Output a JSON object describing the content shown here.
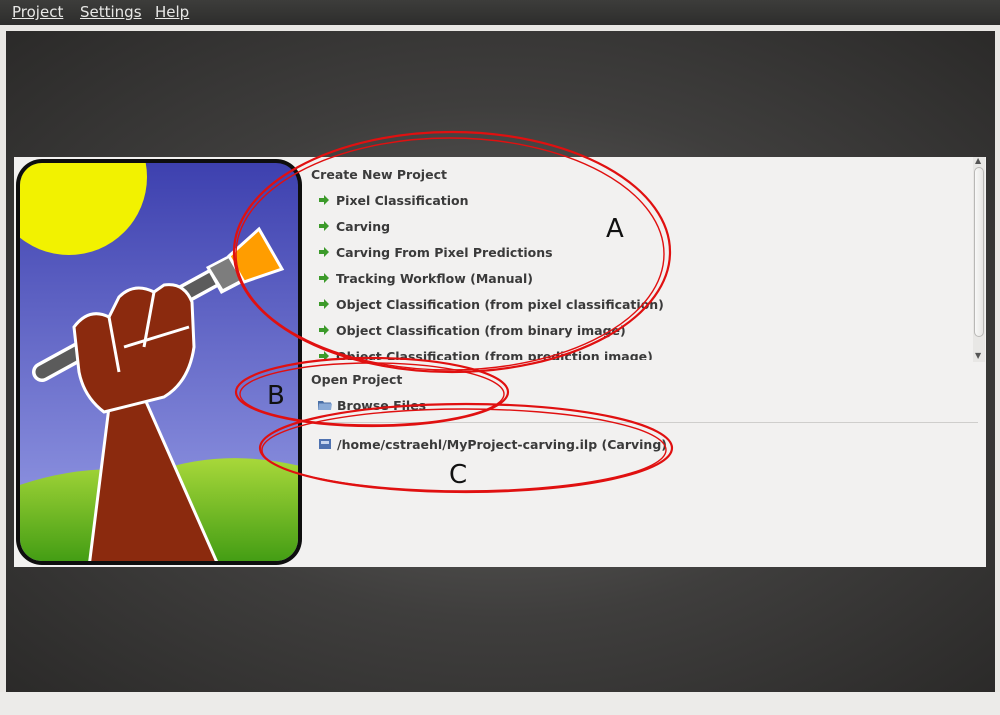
{
  "menubar": {
    "items": [
      {
        "label": "Project"
      },
      {
        "label": "Settings"
      },
      {
        "label": "Help"
      }
    ]
  },
  "start_panel": {
    "create_title": "Create New Project",
    "workflows": [
      {
        "label": "Pixel Classification"
      },
      {
        "label": "Carving"
      },
      {
        "label": "Carving From Pixel Predictions"
      },
      {
        "label": "Tracking Workflow (Manual)"
      },
      {
        "label": "Object Classification (from pixel classification)"
      },
      {
        "label": "Object Classification (from binary image)"
      },
      {
        "label": "Object Classification (from prediction image)"
      }
    ],
    "open_title": "Open Project",
    "browse_label": "Browse Files",
    "recent_projects": [
      {
        "label": "/home/cstraehl/MyProject-carving.ilp (Carving)"
      }
    ]
  },
  "annotations": {
    "a": "A",
    "b": "B",
    "c": "C"
  },
  "colors": {
    "menubar": "#333332",
    "arrow_icon": "#3c9a2a",
    "highlight_ellipse": "#e01010",
    "logo_sky": "#5a5ec0",
    "logo_sun": "#f2f200",
    "logo_arm": "#8b2a0e",
    "logo_grass": "#6cb61f"
  }
}
